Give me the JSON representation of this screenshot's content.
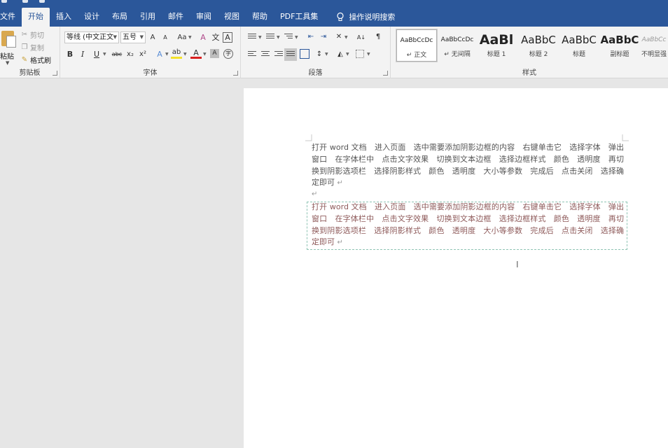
{
  "title_bar": {
    "title": ""
  },
  "tabs": [
    {
      "label": "文件"
    },
    {
      "label": "开始"
    },
    {
      "label": "插入"
    },
    {
      "label": "设计"
    },
    {
      "label": "布局"
    },
    {
      "label": "引用"
    },
    {
      "label": "邮件"
    },
    {
      "label": "审阅"
    },
    {
      "label": "视图"
    },
    {
      "label": "帮助"
    },
    {
      "label": "PDF工具集"
    },
    {
      "label": "操作说明搜索"
    }
  ],
  "clipboard": {
    "paste": "粘贴",
    "cut": "剪切",
    "copy": "复制",
    "format_painter": "格式刷",
    "group_label": "剪贴板"
  },
  "font": {
    "font_name": "等线 (中文正文",
    "font_size": "五号",
    "grow": "A",
    "shrink": "A",
    "change_case": "Aa",
    "clear_format": "A",
    "char_border": "A",
    "bold": "B",
    "italic": "I",
    "underline": "U",
    "strike": "abc",
    "subscript": "x₂",
    "superscript": "x²",
    "text_effects": "A",
    "highlight": "ab",
    "font_color": "A",
    "char_shading": "A",
    "enclose": "字",
    "group_label": "字体"
  },
  "paragraph": {
    "sort": "A↓",
    "group_label": "段落"
  },
  "styles": {
    "items": [
      {
        "sample": "AaBbCcDc",
        "name": "↵ 正文"
      },
      {
        "sample": "AaBbCcDc",
        "name": "↵ 无间隔"
      },
      {
        "sample": "AaBl",
        "name": "标题 1"
      },
      {
        "sample": "AaBbC",
        "name": "标题 2"
      },
      {
        "sample": "AaBbC",
        "name": "标题"
      },
      {
        "sample": "AaBbC",
        "name": "副标题"
      },
      {
        "sample": "AaBbCc",
        "name": "不明显强"
      }
    ],
    "group_label": "样式"
  },
  "document": {
    "paragraph1": "打开 word 文档　进入页面　选中需要添加阴影边框的内容　右键单击它　选择字体　弹出窗口　在字体栏中　点击文字效果　切换到文本边框　选择边框样式　颜色　透明度　再切换到阴影选项栏　选择阴影样式　颜色　透明度　大小等参数　完成后　点击关闭　选择确定即可",
    "paragraph_mark": "↵",
    "paragraph2": "打开 word 文档　进入页面　选中需要添加阴影边框的内容　右键单击它　选择字体　弹出窗口　在字体栏中　点击文字效果　切换到文本边框　选择边框样式　颜色　透明度　再切换到阴影选项栏　选择阴影样式　颜色　透明度　大小等参数　完成后　点击关闭　选择确定即可"
  },
  "colors": {
    "ribbon_blue": "#2b579a",
    "ribbon_bg": "#f3f3f3",
    "shadow_text": "#8e5a5a",
    "border_dash": "#8fc4b4"
  }
}
